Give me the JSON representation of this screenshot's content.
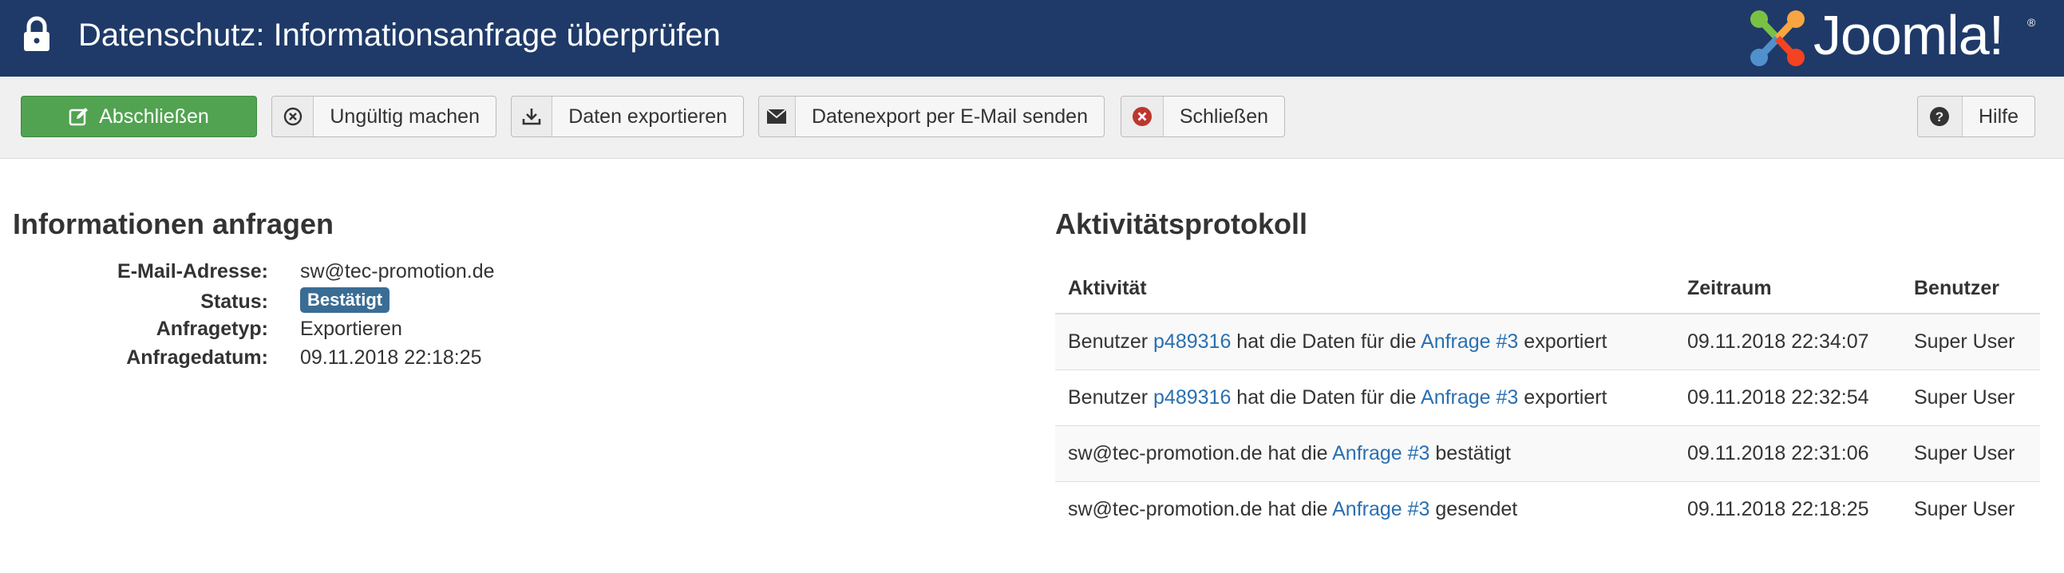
{
  "header": {
    "title": "Datenschutz: Informationsanfrage überprüfen",
    "logo_text": "Joomla!",
    "logo_mark": "®"
  },
  "toolbar": {
    "complete_label": "Abschließen",
    "invalidate_label": "Ungültig machen",
    "export_label": "Daten exportieren",
    "email_export_label": "Datenexport per E-Mail senden",
    "close_label": "Schließen",
    "help_label": "Hilfe"
  },
  "request": {
    "heading": "Informationen anfragen",
    "email_label": "E-Mail-Adresse:",
    "email_value": "sw@tec-promotion.de",
    "status_label": "Status:",
    "status_value": "Bestätigt",
    "type_label": "Anfragetyp:",
    "type_value": "Exportieren",
    "date_label": "Anfragedatum:",
    "date_value": "09.11.2018 22:18:25"
  },
  "log": {
    "heading": "Aktivitätsprotokoll",
    "columns": [
      "Aktivität",
      "Zeitraum",
      "Benutzer"
    ],
    "rows": [
      {
        "pre": "Benutzer ",
        "user_link": "p489316",
        "mid": " hat die Daten für die ",
        "req_link": "Anfrage #3",
        "post": " exportiert",
        "time": "09.11.2018 22:34:07",
        "user": "Super User"
      },
      {
        "pre": "Benutzer ",
        "user_link": "p489316",
        "mid": " hat die Daten für die ",
        "req_link": "Anfrage #3",
        "post": " exportiert",
        "time": "09.11.2018 22:32:54",
        "user": "Super User"
      },
      {
        "pre": "sw@tec-promotion.de hat die ",
        "req_link": "Anfrage #3",
        "post": " bestätigt",
        "time": "09.11.2018 22:31:06",
        "user": "Super User"
      },
      {
        "pre": "sw@tec-promotion.de hat die ",
        "req_link": "Anfrage #3",
        "post": " gesendet",
        "time": "09.11.2018 22:18:25",
        "user": "Super User"
      }
    ]
  },
  "icons": {
    "header": "lock-icon",
    "complete": "edit-icon",
    "invalidate": "cancel-circle-icon",
    "export": "download-icon",
    "email": "envelope-icon",
    "close": "close-circle-icon",
    "help": "question-circle-icon"
  },
  "colors": {
    "header_bg": "#1f3a68",
    "success": "#51a351",
    "badge": "#3a6d94",
    "link": "#2a6fb0",
    "danger": "#bd362f"
  }
}
